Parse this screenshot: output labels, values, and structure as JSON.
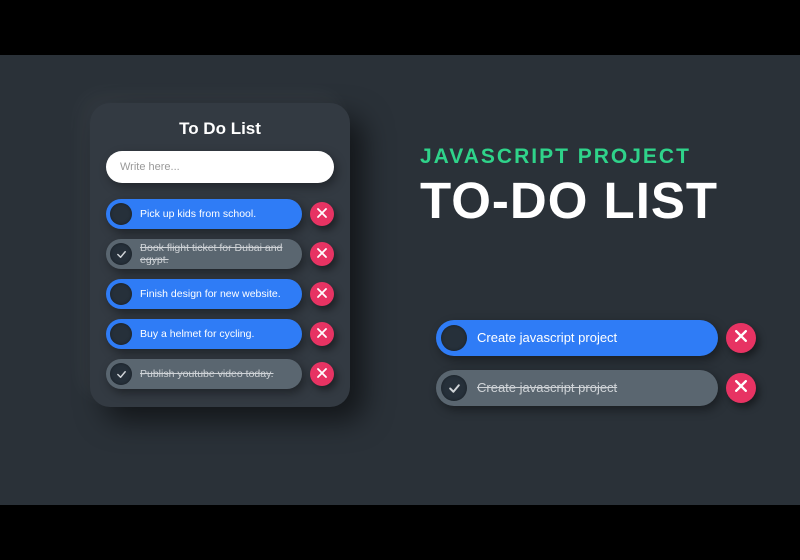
{
  "card": {
    "title": "To Do List",
    "input_placeholder": "Write here..."
  },
  "tasks": [
    {
      "label": "Pick up kids from school.",
      "done": false
    },
    {
      "label": "Book flight ticket for Dubai and egypt.",
      "done": true
    },
    {
      "label": "Finish design for new website.",
      "done": false
    },
    {
      "label": "Buy a helmet for cycling.",
      "done": false
    },
    {
      "label": "Publish youtube video today.",
      "done": true
    }
  ],
  "hero": {
    "subtitle": "JAVASCRIPT PROJECT",
    "title": "TO-DO LIST"
  },
  "demo": [
    {
      "label": "Create javascript project",
      "done": false
    },
    {
      "label": "Create javascript project",
      "done": true
    }
  ],
  "colors": {
    "bg": "#2a3138",
    "card": "#333a42",
    "active": "#2f7cf6",
    "done": "#5a6670",
    "delete": "#e73363",
    "accent": "#2fd38a"
  }
}
